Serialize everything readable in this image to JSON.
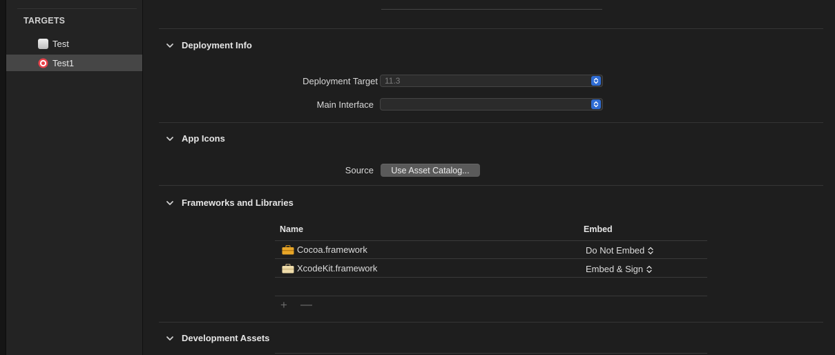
{
  "sidebar": {
    "header": "TARGETS",
    "targets": [
      {
        "label": "Test",
        "icon": "app-icon",
        "selected": false
      },
      {
        "label": "Test1",
        "icon": "target-icon",
        "selected": true
      }
    ]
  },
  "sections": {
    "deployment_info": {
      "title": "Deployment Info",
      "deployment_target_label": "Deployment Target",
      "deployment_target_value": "11.3",
      "main_interface_label": "Main Interface",
      "main_interface_value": ""
    },
    "app_icons": {
      "title": "App Icons",
      "source_label": "Source",
      "source_button": "Use Asset Catalog..."
    },
    "frameworks": {
      "title": "Frameworks and Libraries",
      "columns": [
        "Name",
        "Embed"
      ],
      "rows": [
        {
          "name": "Cocoa.framework",
          "embed": "Do Not Embed",
          "icon": "toolbox-icon"
        },
        {
          "name": "XcodeKit.framework",
          "embed": "Embed & Sign",
          "icon": "toolbox-icon"
        }
      ],
      "add_symbol": "+",
      "remove_symbol": "—"
    },
    "development_assets": {
      "title": "Development Assets"
    }
  },
  "colors": {
    "accent": "#2f6cd3",
    "selected_row": "#464646",
    "target_icon": "#e8414a"
  }
}
